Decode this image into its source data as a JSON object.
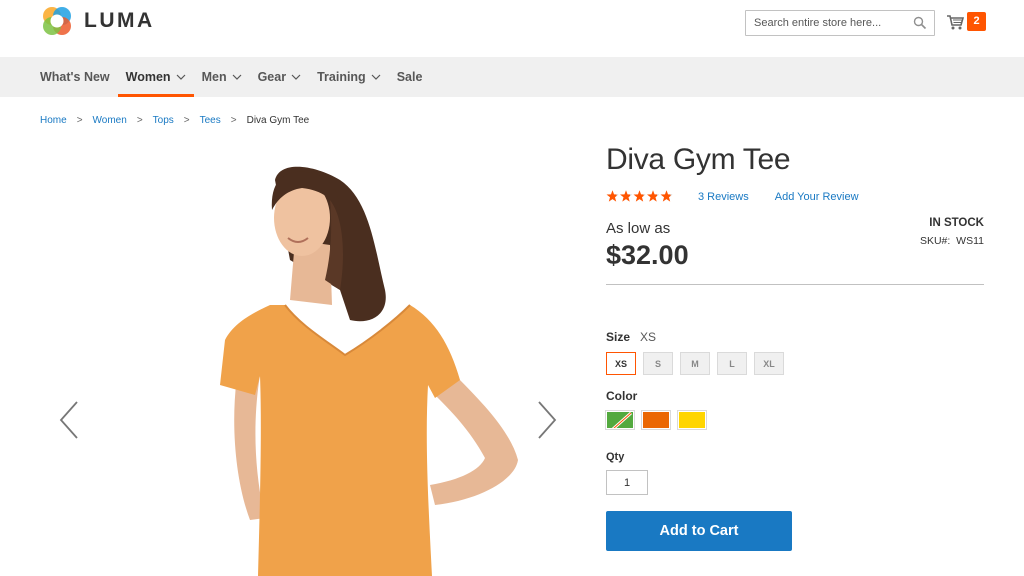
{
  "brand": {
    "name": "LUMA"
  },
  "search": {
    "placeholder": "Search entire store here..."
  },
  "cart": {
    "count": "2"
  },
  "nav": {
    "items": [
      {
        "label": "What's New",
        "dropdown": false
      },
      {
        "label": "Women",
        "dropdown": true,
        "active": true
      },
      {
        "label": "Men",
        "dropdown": true
      },
      {
        "label": "Gear",
        "dropdown": true
      },
      {
        "label": "Training",
        "dropdown": true
      },
      {
        "label": "Sale",
        "dropdown": false
      }
    ]
  },
  "breadcrumb": {
    "items": [
      "Home",
      "Women",
      "Tops",
      "Tees"
    ],
    "current": "Diva Gym Tee"
  },
  "product": {
    "name": "Diva Gym Tee",
    "rating_fraction": 0.85,
    "reviews_label": "3  Reviews",
    "add_review_label": "Add Your Review",
    "price_prefix": "As low as",
    "price": "$32.00",
    "stock": "IN STOCK",
    "sku_label": "SKU#:",
    "sku": "WS11"
  },
  "options": {
    "size_label": "Size",
    "size_selected": "XS",
    "sizes": [
      "XS",
      "S",
      "M",
      "L",
      "XL"
    ],
    "color_label": "Color",
    "colors": [
      "#53a93f",
      "#eb6703",
      "#ffd500"
    ],
    "qty_label": "Qty",
    "qty_value": "1"
  },
  "actions": {
    "add_to_cart": "Add to Cart"
  },
  "theme": {
    "accent": "#ff5501",
    "primary": "#1979c3"
  }
}
